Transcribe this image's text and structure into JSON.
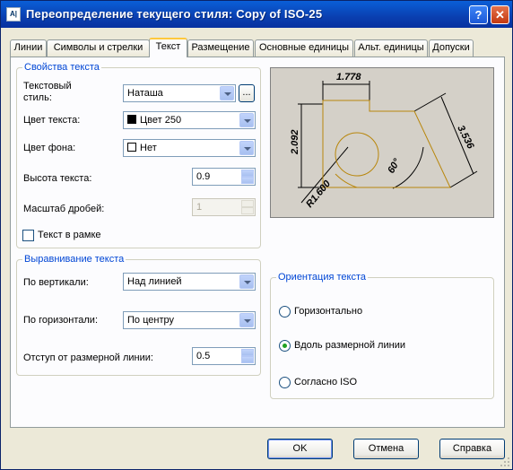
{
  "window": {
    "title": "Переопределение текущего стиля: Copy of ISO-25",
    "app_icon": "autocad-dim-icon",
    "help_label": "?",
    "close_label": "✕"
  },
  "tabs": [
    "Линии",
    "Символы и стрелки",
    "Текст",
    "Размещение",
    "Основные единицы",
    "Альт. единицы",
    "Допуски"
  ],
  "active_tab": "Текст",
  "text_props": {
    "title": "Свойства текста",
    "style_label_1": "Текстовый",
    "style_label_2": "стиль:",
    "style_value": "Наташа",
    "style_btn_label": "...",
    "color_label": "Цвет текста:",
    "color_value": "Цвет 250",
    "color_swatch": "#000000",
    "fill_label": "Цвет фона:",
    "fill_value": "Нет",
    "fill_swatch": "#ffffff",
    "height_label": "Высота текста:",
    "height_value": "0.9",
    "fraction_label": "Масштаб дробей:",
    "fraction_value": "1",
    "frame_label": "Текст в рамке",
    "frame_checked": false
  },
  "alignment": {
    "title": "Выравнивание текста",
    "vertical_label": "По вертикали:",
    "vertical_value": "Над линией",
    "horizontal_label": "По горизонтали:",
    "horizontal_value": "По центру",
    "offset_label": "Отступ от размерной линии:",
    "offset_value": "0.5"
  },
  "orientation": {
    "title": "Ориентация текста",
    "options": [
      "Горизонтально",
      "Вдоль размерной линии",
      "Согласно ISO"
    ],
    "selected": "Вдоль размерной линии"
  },
  "preview": {
    "dim_top": "1.778",
    "dim_left": "2.092",
    "dim_right": "3.536",
    "dim_angle": "60°",
    "dim_radius": "R1.600"
  },
  "buttons": {
    "ok": "OK",
    "cancel": "Отмена",
    "help": "Справка"
  }
}
